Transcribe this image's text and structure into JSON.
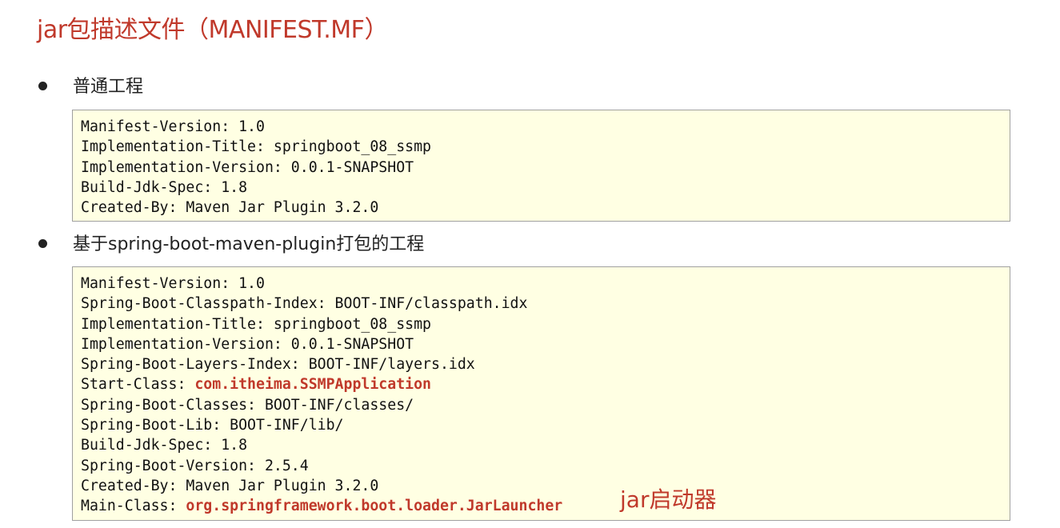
{
  "title": "jar包描述文件（MANIFEST.MF）",
  "sections": [
    {
      "heading": "普通工程",
      "lines": [
        {
          "key": "Manifest-Version: ",
          "value": "1.0"
        },
        {
          "key": "Implementation-Title: ",
          "value": "springboot_08_ssmp"
        },
        {
          "key": "Implementation-Version: ",
          "value": "0.0.1-SNAPSHOT"
        },
        {
          "key": "Build-Jdk-Spec: ",
          "value": "1.8"
        },
        {
          "key": "Created-By: ",
          "value": "Maven Jar Plugin 3.2.0"
        }
      ]
    },
    {
      "heading": "基于spring-boot-maven-plugin打包的工程",
      "lines": [
        {
          "key": "Manifest-Version: ",
          "value": "1.0"
        },
        {
          "key": "Spring-Boot-Classpath-Index: ",
          "value": "BOOT-INF/classpath.idx"
        },
        {
          "key": "Implementation-Title: ",
          "value": "springboot_08_ssmp"
        },
        {
          "key": "Implementation-Version: ",
          "value": "0.0.1-SNAPSHOT"
        },
        {
          "key": "Spring-Boot-Layers-Index: ",
          "value": "BOOT-INF/layers.idx"
        },
        {
          "key": "Start-Class: ",
          "value": "com.itheima.SSMPApplication"
        },
        {
          "key": "Spring-Boot-Classes: ",
          "value": "BOOT-INF/classes/"
        },
        {
          "key": "Spring-Boot-Lib: ",
          "value": "BOOT-INF/lib/"
        },
        {
          "key": "Build-Jdk-Spec: ",
          "value": "1.8"
        },
        {
          "key": "Spring-Boot-Version: ",
          "value": "2.5.4"
        },
        {
          "key": "Created-By: ",
          "value": "Maven Jar Plugin 3.2.0"
        },
        {
          "key": "Main-Class: ",
          "value": "org.springframework.boot.loader.JarLauncher"
        }
      ]
    }
  ],
  "launcher_note": "jar启动器",
  "colors": {
    "accent": "#c0392b",
    "code_bg": "#ffffe3"
  }
}
